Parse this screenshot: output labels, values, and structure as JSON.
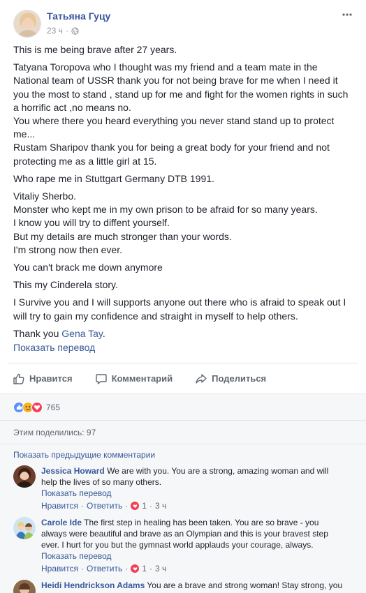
{
  "post": {
    "author": "Татьяна Гуцу",
    "time": "23 ч",
    "privacy_icon": "globe-icon",
    "paragraphs": [
      [
        "This is me being brave after 27 years."
      ],
      [
        "Tatyana Toropova who I thought was my friend and a team mate in the",
        "National team of USSR thank you for not being brave for me when I need it",
        "you the most to stand , stand up for me and fight for the women rights in such",
        "a horrific act ,no means no.",
        "You where there you heard everything you never stand stand up to protect",
        "me...",
        "Rustam Sharipov thank you for being a great body for your friend and not",
        "protecting me as a little girl at 15."
      ],
      [
        "Who rape me in Stuttgart Germany DTB 1991."
      ],
      [
        "Vitaliy Sherbo.",
        "Monster who kept me in my own prison to be afraid for so many years.",
        "I know you will try to diffent yourself.",
        "But my details are much stronger than your words.",
        "I'm strong now then ever."
      ],
      [
        "You can't brack me down anymore"
      ],
      [
        "This my Cinderela story."
      ],
      [
        "I Survive you and I will supports anyone out there who is afraid to speak out I",
        "will try to gain my confidence and straight in myself to help others."
      ]
    ],
    "thanks_prefix": "Thank you ",
    "thanks_mention": "Gena Tay",
    "thanks_suffix": ".",
    "see_translation": "Показать перевод"
  },
  "actions": {
    "like": "Нравится",
    "comment": "Комментарий",
    "share": "Поделиться"
  },
  "reactions": {
    "icons": [
      "like-reaction-icon",
      "sad-reaction-icon",
      "love-reaction-icon"
    ],
    "count": "765"
  },
  "shares": {
    "label": "Этим поделились: 97"
  },
  "comments": {
    "prev_label": "Показать предыдущие комментарии",
    "items": [
      {
        "name": "Jessica Howard",
        "text_first": "We are with you. You are a strong, amazing woman and will",
        "text_rest": [
          "help the lives of so many others."
        ],
        "translation": "Показать перевод",
        "like": "Нравится",
        "reply": "Ответить",
        "reactions": "1",
        "time": "3 ч"
      },
      {
        "name": "Carole Ide",
        "text_first": "The first step in healing has been taken. You are so brave - you",
        "text_rest": [
          "always were beautiful and brave as an Olympian and this is your bravest step",
          "ever. I hurt for you but the gymnast world applauds your courage, always."
        ],
        "translation": "Показать перевод",
        "like": "Нравится",
        "reply": "Ответить",
        "reactions": "1",
        "time": "3 ч"
      },
      {
        "name": "Heidi Hendrickson Adams",
        "text_first": "You are a brave and strong woman! Stay strong, you",
        "text_rest": [],
        "translation": "",
        "like": "",
        "reply": "",
        "reactions": "",
        "time": ""
      }
    ]
  },
  "colors": {
    "link": "#365899",
    "text": "#1d2129",
    "muted": "#90949c",
    "like_blue": "#5890ff",
    "love_red": "#f33e58",
    "sad_yellow": "#f7b125"
  }
}
